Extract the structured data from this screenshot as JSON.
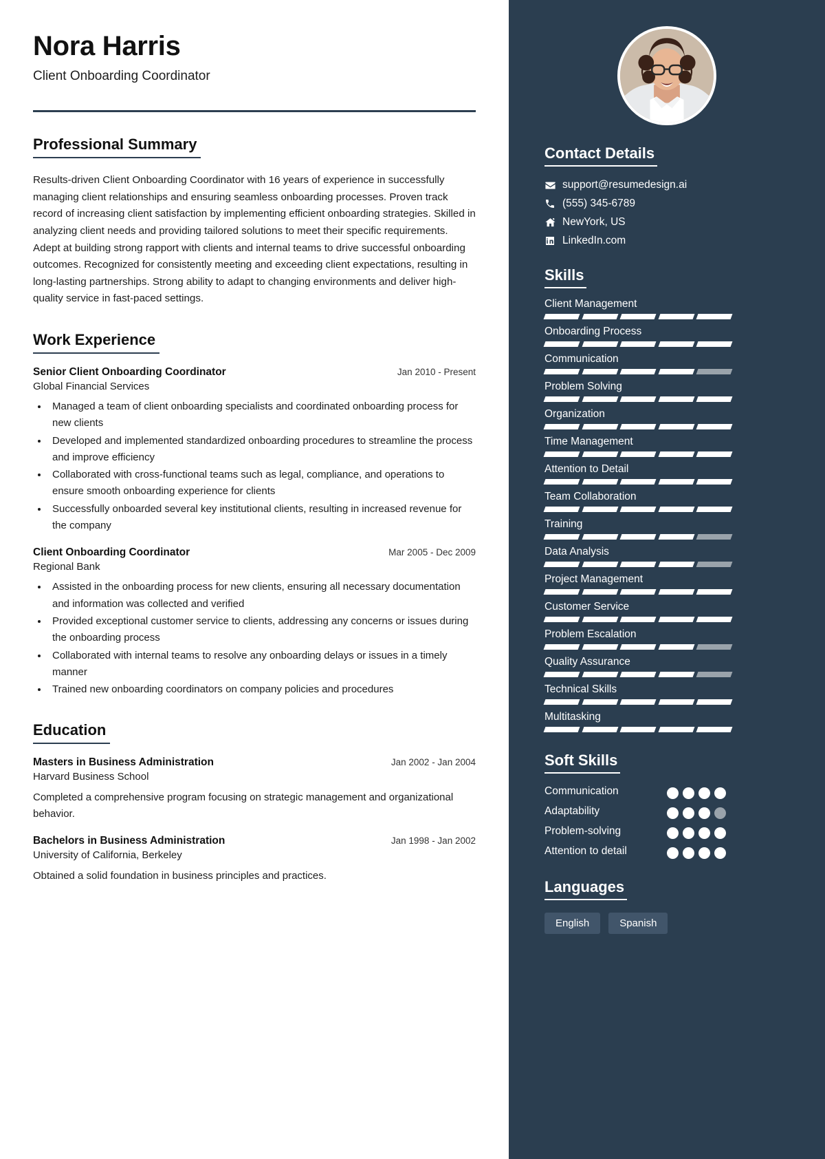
{
  "header": {
    "name": "Nora Harris",
    "job_title": "Client Onboarding Coordinator"
  },
  "colors": {
    "sidebar_bg": "#2b3e50",
    "rule": "#2c3e50",
    "segment_on": "#ffffff",
    "segment_off": "#9aa3ab",
    "chip_bg": "#41556a"
  },
  "summary": {
    "title": "Professional Summary",
    "text": "Results-driven Client Onboarding Coordinator with 16 years of experience in successfully managing client relationships and ensuring seamless onboarding processes. Proven track record of increasing client satisfaction by implementing efficient onboarding strategies. Skilled in analyzing client needs and providing tailored solutions to meet their specific requirements. Adept at building strong rapport with clients and internal teams to drive successful onboarding outcomes. Recognized for consistently meeting and exceeding client expectations, resulting in long-lasting partnerships. Strong ability to adapt to changing environments and deliver high-quality service in fast-paced settings."
  },
  "work": {
    "title": "Work Experience",
    "jobs": [
      {
        "position": "Senior Client Onboarding Coordinator",
        "date": "Jan 2010 - Present",
        "organization": "Global Financial Services",
        "bullets": [
          "Managed a team of client onboarding specialists and coordinated onboarding process for new clients",
          "Developed and implemented standardized onboarding procedures to streamline the process and improve efficiency",
          "Collaborated with cross-functional teams such as legal, compliance, and operations to ensure smooth onboarding experience for clients",
          "Successfully onboarded several key institutional clients, resulting in increased revenue for the company"
        ]
      },
      {
        "position": "Client Onboarding Coordinator",
        "date": "Mar 2005 - Dec 2009",
        "organization": "Regional Bank",
        "bullets": [
          "Assisted in the onboarding process for new clients, ensuring all necessary documentation and information was collected and verified",
          "Provided exceptional customer service to clients, addressing any concerns or issues during the onboarding process",
          "Collaborated with internal teams to resolve any onboarding delays or issues in a timely manner",
          "Trained new onboarding coordinators on company policies and procedures"
        ]
      }
    ]
  },
  "education": {
    "title": "Education",
    "items": [
      {
        "degree": "Masters in Business Administration",
        "date": "Jan 2002 - Jan 2004",
        "school": "Harvard Business School",
        "description": "Completed a comprehensive program focusing on strategic management and organizational behavior."
      },
      {
        "degree": "Bachelors in Business Administration",
        "date": "Jan 1998 - Jan 2002",
        "school": "University of California, Berkeley",
        "description": "Obtained a solid foundation in business principles and practices."
      }
    ]
  },
  "contact": {
    "title": "Contact Details",
    "items": [
      {
        "icon": "envelope-icon",
        "value": "support@resumedesign.ai"
      },
      {
        "icon": "phone-icon",
        "value": "(555) 345-6789"
      },
      {
        "icon": "home-icon",
        "value": "NewYork, US"
      },
      {
        "icon": "linkedin-icon",
        "value": "LinkedIn.com"
      }
    ]
  },
  "skills": {
    "title": "Skills",
    "segments_total": 5,
    "items": [
      {
        "name": "Client Management",
        "filled": 5
      },
      {
        "name": "Onboarding Process",
        "filled": 5
      },
      {
        "name": "Communication",
        "filled": 4
      },
      {
        "name": "Problem Solving",
        "filled": 5
      },
      {
        "name": "Organization",
        "filled": 5
      },
      {
        "name": "Time Management",
        "filled": 5
      },
      {
        "name": "Attention to Detail",
        "filled": 5
      },
      {
        "name": "Team Collaboration",
        "filled": 5
      },
      {
        "name": "Training",
        "filled": 4
      },
      {
        "name": "Data Analysis",
        "filled": 4
      },
      {
        "name": "Project Management",
        "filled": 5
      },
      {
        "name": "Customer Service",
        "filled": 5
      },
      {
        "name": "Problem Escalation",
        "filled": 4
      },
      {
        "name": "Quality Assurance",
        "filled": 4
      },
      {
        "name": "Technical Skills",
        "filled": 5
      },
      {
        "name": "Multitasking",
        "filled": 5
      }
    ]
  },
  "soft_skills": {
    "title": "Soft Skills",
    "dots_total": 4,
    "items": [
      {
        "name": "Communication",
        "filled": 4
      },
      {
        "name": "Adaptability",
        "filled": 3
      },
      {
        "name": "Problem-solving",
        "filled": 4
      },
      {
        "name": "Attention to detail",
        "filled": 4
      }
    ]
  },
  "languages": {
    "title": "Languages",
    "items": [
      "English",
      "Spanish"
    ]
  }
}
